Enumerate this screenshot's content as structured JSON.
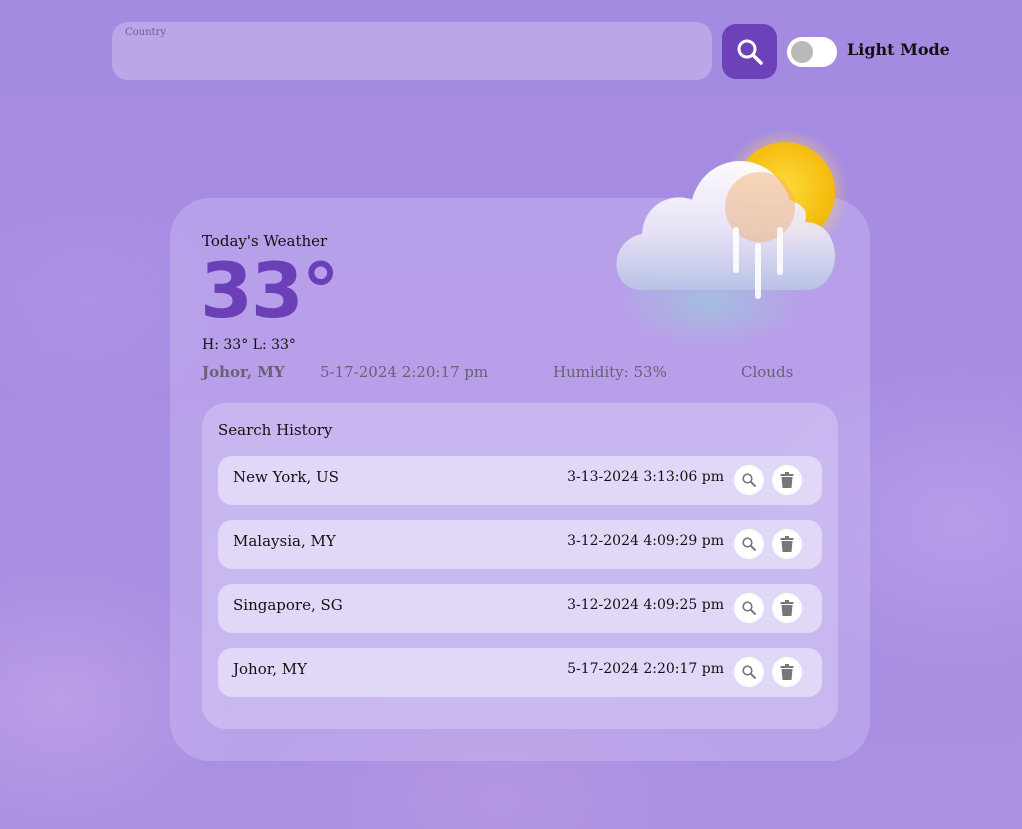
{
  "search": {
    "label": "Country",
    "value": "",
    "button_icon": "magnifier-icon"
  },
  "theme_toggle": {
    "label": "Light Mode",
    "on": false
  },
  "weather": {
    "heading": "Today's Weather",
    "temperature": "33°",
    "high_low": "H: 33° L: 33°",
    "location": "Johor, MY",
    "datetime": "5-17-2024 2:20:17 pm",
    "humidity": "Humidity: 53%",
    "condition": "Clouds",
    "icon": "cloud-rain-sun-icon"
  },
  "history": {
    "title": "Search History",
    "items": [
      {
        "city": "New York, US",
        "time": "3-13-2024 3:13:06 pm"
      },
      {
        "city": "Malaysia, MY",
        "time": "3-12-2024 4:09:29 pm"
      },
      {
        "city": "Singapore, SG",
        "time": "3-12-2024 4:09:25 pm"
      },
      {
        "city": "Johor, MY",
        "time": "5-17-2024 2:20:17 pm"
      }
    ]
  },
  "colors": {
    "accent": "#6a3fb8",
    "search_button": "#6c41ba",
    "background": "#a48ae2"
  }
}
